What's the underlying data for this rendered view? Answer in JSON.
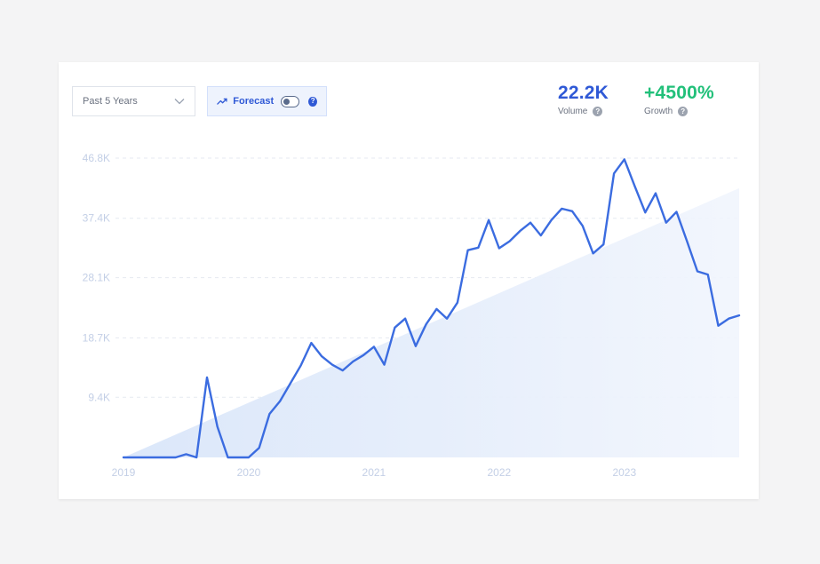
{
  "controls": {
    "range_label": "Past 5 Years",
    "forecast_label": "Forecast",
    "forecast_on": false
  },
  "metrics": {
    "volume_value": "22.2K",
    "volume_label": "Volume",
    "growth_value": "+4500%",
    "growth_label": "Growth"
  },
  "colors": {
    "line": "#3b6ce0",
    "volume": "#2f59d6",
    "growth": "#22c07a",
    "trend_fill": "#dbe7fa",
    "tick": "#c3cfe6",
    "grid": "#e6eaf1"
  },
  "chart_data": {
    "type": "line",
    "x_start": "2019-01",
    "x_step": "month",
    "ylim": [
      0,
      46800
    ],
    "yticks": [
      "9.4K",
      "18.7K",
      "28.1K",
      "37.4K",
      "46.8K"
    ],
    "ytick_values": [
      9400,
      18700,
      28100,
      37400,
      46800
    ],
    "xticks": [
      "2019",
      "2020",
      "2021",
      "2022",
      "2023"
    ],
    "grid": true,
    "trend": {
      "start": 0,
      "end": 42100
    },
    "series": [
      {
        "values": [
          0,
          0,
          0,
          0,
          0,
          0,
          500,
          0,
          12500,
          4800,
          0,
          0,
          0,
          1500,
          6800,
          8800,
          11600,
          14400,
          17900,
          15800,
          14500,
          13600,
          15000,
          16000,
          17300,
          14500,
          20300,
          21700,
          17400,
          20800,
          23200,
          21700,
          24200,
          32400,
          32800,
          37100,
          32700,
          33800,
          35400,
          36700,
          34700,
          37100,
          38900,
          38500,
          36200,
          31900,
          33300,
          44400,
          46600,
          42400,
          38300,
          41300,
          36700,
          38400,
          33800,
          29100,
          28600,
          20600,
          21700,
          22200
        ]
      }
    ]
  }
}
